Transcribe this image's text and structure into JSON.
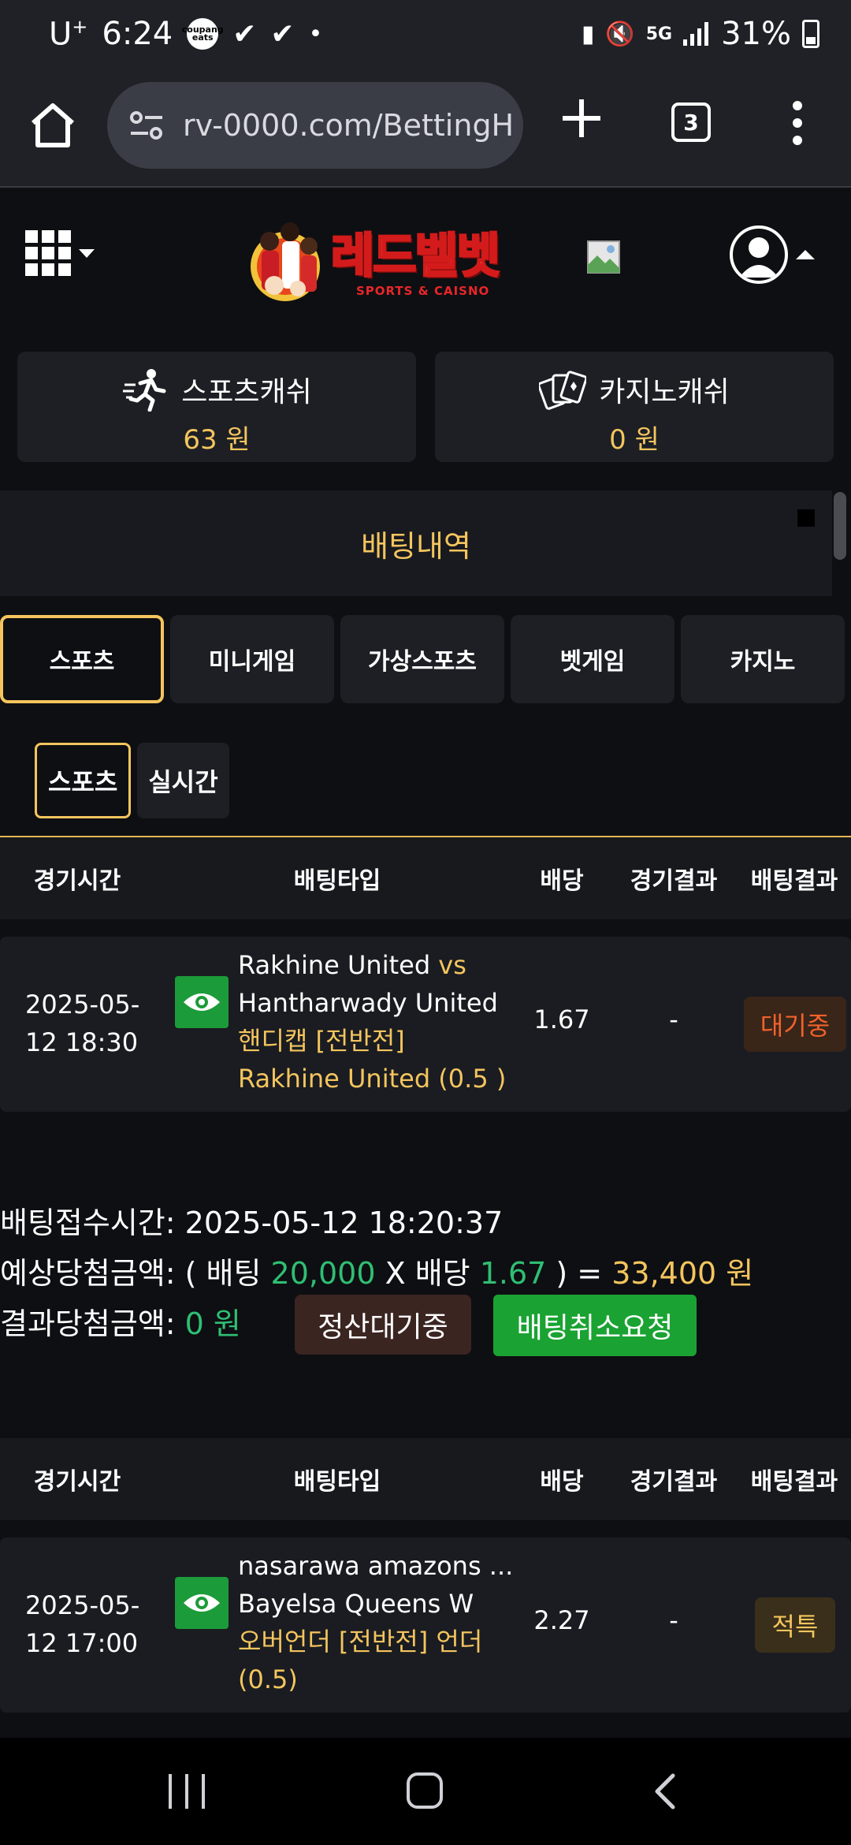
{
  "status_bar": {
    "carrier": "U",
    "carrier_sup": "+",
    "time": "6:24",
    "app_badge": "coupang eats",
    "network": "5G",
    "battery": "31%"
  },
  "browser": {
    "url": "rv-0000.com/BettingH",
    "tab_count": "3"
  },
  "site": {
    "logo_title": "레드벨벳",
    "logo_subtitle": "SPORTS & CAISNO"
  },
  "wallets": [
    {
      "label": "스포츠캐쉬",
      "amount": "63 원",
      "icon": "runner-icon"
    },
    {
      "label": "카지노캐쉬",
      "amount": "0 원",
      "icon": "cards-icon"
    }
  ],
  "section_title": "배팅내역",
  "main_tabs": [
    "스포츠",
    "미니게임",
    "가상스포츠",
    "벳게임",
    "카지노"
  ],
  "sub_tabs": [
    "스포츠",
    "실시간"
  ],
  "table_headers": {
    "time": "경기시간",
    "type": "배팅타입",
    "odds": "배당",
    "game_result": "경기결과",
    "bet_result": "배팅결과"
  },
  "bets": [
    {
      "time_line1": "2025-05-",
      "time_line2": "12 18:30",
      "home": "Rakhine United",
      "vs": "vs",
      "away": "Hantharwady United",
      "market_line1": "핸디캡 [전반전]",
      "market_line2": "Rakhine United (0.5 )",
      "odds": "1.67",
      "game_result": "-",
      "bet_result": "대기중"
    },
    {
      "time_line1": "2025-05-",
      "time_line2": "12 17:00",
      "home": "nasarawa amazons ...",
      "away": "Bayelsa Queens W",
      "market_line1": "오버언더 [전반전] 언더",
      "market_line2": "(0.5)",
      "odds": "2.27",
      "game_result": "-",
      "bet_result": "적특"
    }
  ],
  "summary": {
    "received_label": "배팅접수시간: ",
    "received_time": "2025-05-12 18:20:37",
    "expected_label": "예상당첨금액: ( 배팅 ",
    "stake": "20,000",
    "x_label": " X 배당 ",
    "odds": "1.67",
    "eq_label": " ) = ",
    "expected_amount": "33,400 원",
    "result_label": "결과당첨금액: ",
    "result_amount": "0 원",
    "settle_button": "정산대기중",
    "cancel_button": "배팅취소요청"
  },
  "colors": {
    "accent_gold": "#f4c55e",
    "green": "#2fbf73",
    "cancel_green": "#1aa332",
    "wait_orange": "#f2622a"
  }
}
